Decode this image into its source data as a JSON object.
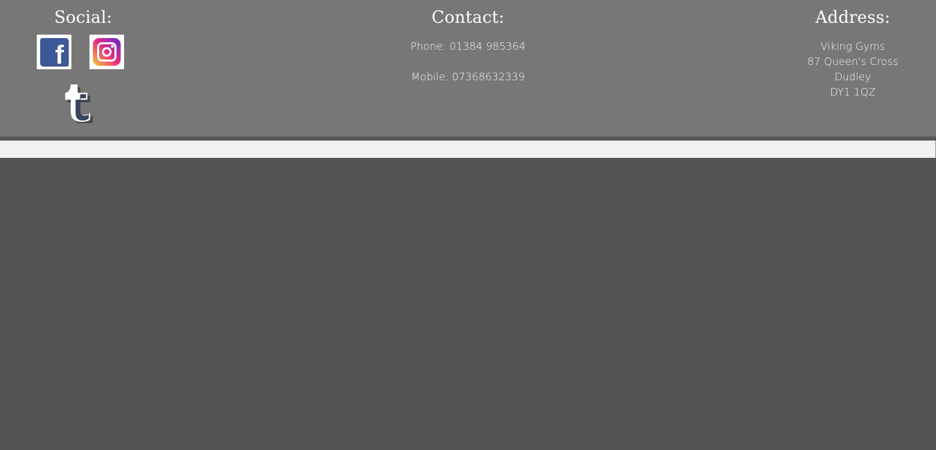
{
  "social": {
    "heading": "Social:",
    "icons": [
      "facebook-icon",
      "instagram-icon",
      "tumblr-icon"
    ]
  },
  "contact": {
    "heading": "Contact:",
    "phone": "Phone: 01384 985364",
    "mobile": "Mobile: 07368632339"
  },
  "address": {
    "heading": "Address:",
    "lines": [
      "Viking Gyms",
      "87 Queen's Cross",
      "Dudley",
      "DY1 1QZ"
    ]
  },
  "colors": {
    "footer_bg": "#777777",
    "page_bg": "#545454",
    "strip_bg": "#f0f1f2",
    "text": "#ffffff"
  }
}
